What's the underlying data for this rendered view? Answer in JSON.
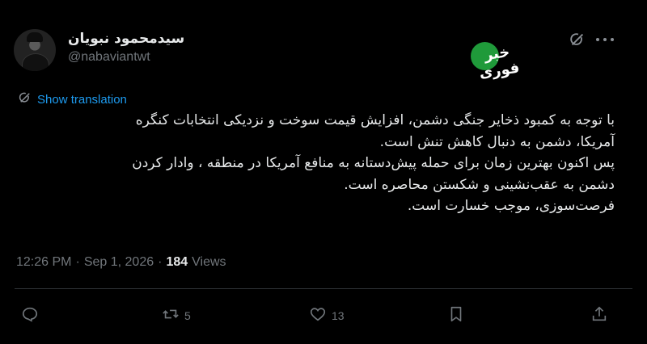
{
  "author": {
    "display_name": "سیدمحمود نبویان",
    "handle": "@nabaviantwt"
  },
  "watermark": {
    "text": "خبر فوری",
    "color": "#1f9a3a"
  },
  "icons": {
    "grok": "grok-icon",
    "more": "more-icon",
    "translate": "translate-icon",
    "reply": "reply-icon",
    "retweet": "retweet-icon",
    "like": "like-icon",
    "bookmark": "bookmark-icon",
    "share": "share-icon"
  },
  "show_translation": "Show translation",
  "body_lines": [
    "با توجه به کمبود ذخایر جنگی دشمن، افزایش قیمت سوخت و نزدیکی انتخابات کنگره",
    "آمریکا، دشمن به دنبال کاهش تنش است.",
    "پس اکنون بهترین زمان برای حمله پیش‌دستانه به منافع آمریکا در منطقه ، وادار کردن",
    "دشمن به عقب‌نشینی و شکستن محاصره است.",
    "فرصت‌سوزی، موجب خسارت است."
  ],
  "meta": {
    "time": "12:26 PM",
    "separator": "·",
    "date": "Sep 1, 2026",
    "views_count": "184",
    "views_label": "Views"
  },
  "actions": {
    "retweet_count": "5",
    "like_count": "13"
  },
  "colors": {
    "background": "#000000",
    "text": "#e7e9ea",
    "muted": "#71767b",
    "link": "#1d9bf0"
  }
}
